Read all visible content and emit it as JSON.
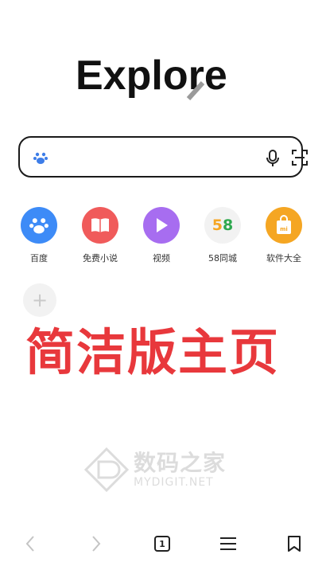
{
  "logo": {
    "text": "Explore"
  },
  "search": {
    "value": "",
    "placeholder": ""
  },
  "shortcuts": [
    {
      "label": "百度",
      "icon": "baidu-paw-icon",
      "color": "#3d8bf7"
    },
    {
      "label": "免费小说",
      "icon": "book-icon",
      "color": "#f05b5b"
    },
    {
      "label": "视频",
      "icon": "video-play-icon",
      "color": "#a76df0"
    },
    {
      "label": "58同城",
      "icon": "58-logo-icon",
      "badge": "58",
      "color": "#f2f2f2"
    },
    {
      "label": "软件大全",
      "icon": "app-store-bag-icon",
      "badge": "mi",
      "color": "#f5a623"
    }
  ],
  "add_shortcut": {
    "icon": "plus-icon",
    "symbol": "+"
  },
  "overlay_caption": "简洁版主页",
  "watermark": {
    "cn": "数码之家",
    "en": "MYDIGIT.NET"
  },
  "toolbar": {
    "back": "chevron-left-icon",
    "forward": "chevron-right-icon",
    "tab_count": "1",
    "menu": "hamburger-menu-icon",
    "bookmark": "bookmark-icon"
  },
  "colors": {
    "accent_red": "#e8383c",
    "border": "#1a1a1a"
  }
}
